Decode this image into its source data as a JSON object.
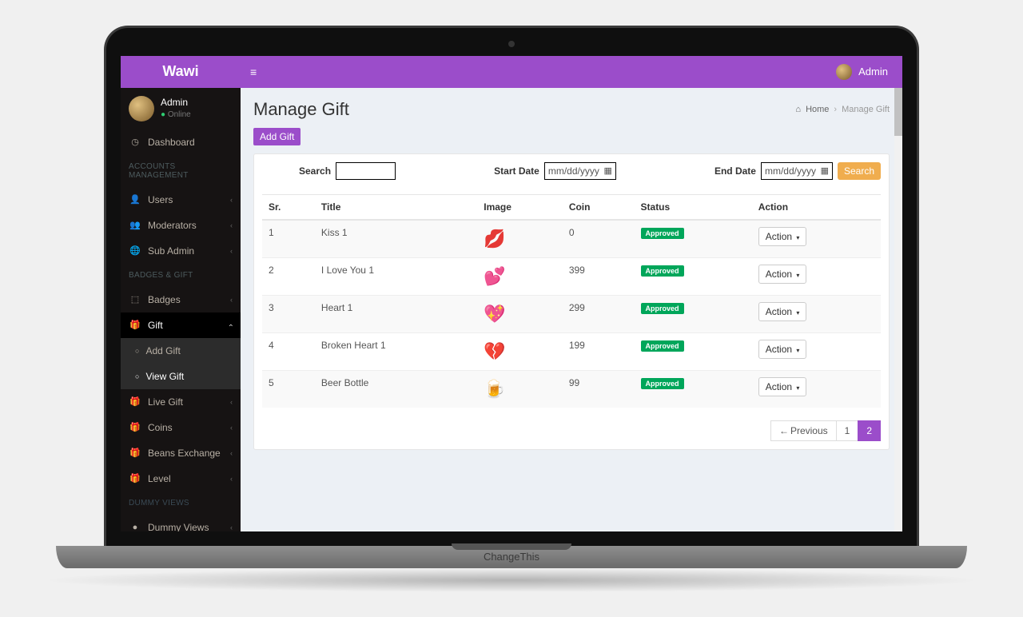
{
  "device_label": "ChangeThis",
  "brand": "Wawi",
  "topbar": {
    "user": "Admin"
  },
  "user_panel": {
    "name": "Admin",
    "status": "Online"
  },
  "sidebar": {
    "dashboard": "Dashboard",
    "section1": "ACCOUNTS MANAGEMENT",
    "users": "Users",
    "moderators": "Moderators",
    "subadmin": "Sub Admin",
    "section2": "BADGES & GIFT",
    "badges": "Badges",
    "gift": "Gift",
    "gift_add": "Add Gift",
    "gift_view": "View Gift",
    "livegift": "Live Gift",
    "coins": "Coins",
    "beans": "Beans Exchange",
    "level": "Level",
    "section3": "Dummy Views",
    "dummy": "Dummy Views"
  },
  "page": {
    "title": "Manage Gift",
    "bc_home": "Home",
    "bc_current": "Manage Gift"
  },
  "actions": {
    "add_gift": "Add Gift",
    "search_label": "Search",
    "start_label": "Start Date",
    "end_label": "End Date",
    "date_placeholder": "mm/dd/yyyy",
    "search_btn": "Search",
    "action_btn": "Action"
  },
  "table": {
    "headers": {
      "sr": "Sr.",
      "title": "Title",
      "image": "Image",
      "coin": "Coin",
      "status": "Status",
      "action": "Action"
    },
    "rows": [
      {
        "sr": "1",
        "title": "Kiss 1",
        "coin": "0",
        "status": "Approved",
        "icon_color": "#d62c3a",
        "glyph": "💋"
      },
      {
        "sr": "2",
        "title": "I Love You 1",
        "coin": "399",
        "status": "Approved",
        "icon_color": "#e84a8f",
        "glyph": "💕"
      },
      {
        "sr": "3",
        "title": "Heart 1",
        "coin": "299",
        "status": "Approved",
        "icon_color": "#e74c3c",
        "glyph": "💖"
      },
      {
        "sr": "4",
        "title": "Broken Heart 1",
        "coin": "199",
        "status": "Approved",
        "icon_color": "#a0a0a0",
        "glyph": "💔"
      },
      {
        "sr": "5",
        "title": "Beer Bottle",
        "coin": "99",
        "status": "Approved",
        "icon_color": "#b57b2e",
        "glyph": "🍺"
      }
    ]
  },
  "pagination": {
    "prev": "Previous",
    "p1": "1",
    "p2": "2"
  }
}
